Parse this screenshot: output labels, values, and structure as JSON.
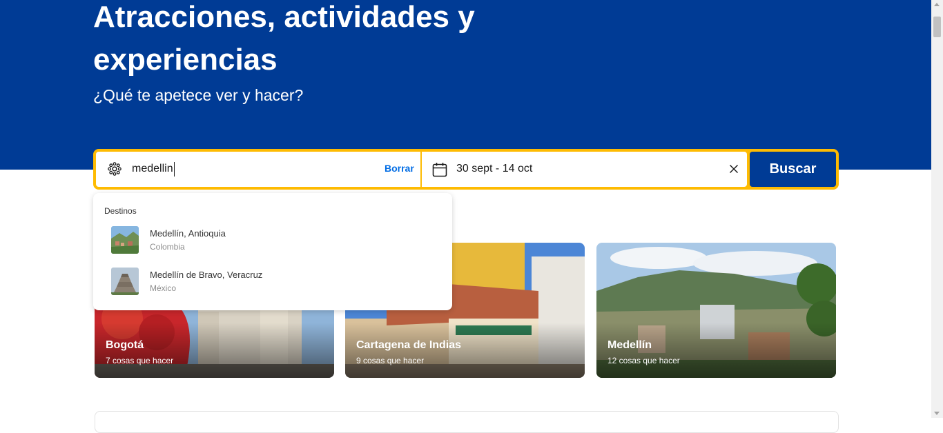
{
  "colors": {
    "brand": "#003b95",
    "accent_yellow": "#febb02",
    "link": "#006ce4"
  },
  "hero": {
    "title": "Atracciones, actividades y experiencias",
    "subtitle": "¿Qué te apetece ver y hacer?"
  },
  "search": {
    "destination_icon": "attractions-icon",
    "destination_value": "medellin",
    "clear_label": "Borrar",
    "date_icon": "calendar-icon",
    "date_range": "30 sept - 14 oct",
    "clear_date_icon": "close-icon",
    "submit_label": "Buscar"
  },
  "suggestions": {
    "header": "Destinos",
    "items": [
      {
        "name": "Medellín, Antioquia",
        "country": "Colombia"
      },
      {
        "name": "Medellín de Bravo, Veracruz",
        "country": "México"
      }
    ]
  },
  "cards": [
    {
      "title": "Bogotá",
      "subtitle": "7 cosas que hacer"
    },
    {
      "title": "Cartagena de Indias",
      "subtitle": "9 cosas que hacer"
    },
    {
      "title": "Medellín",
      "subtitle": "12 cosas que hacer"
    }
  ]
}
